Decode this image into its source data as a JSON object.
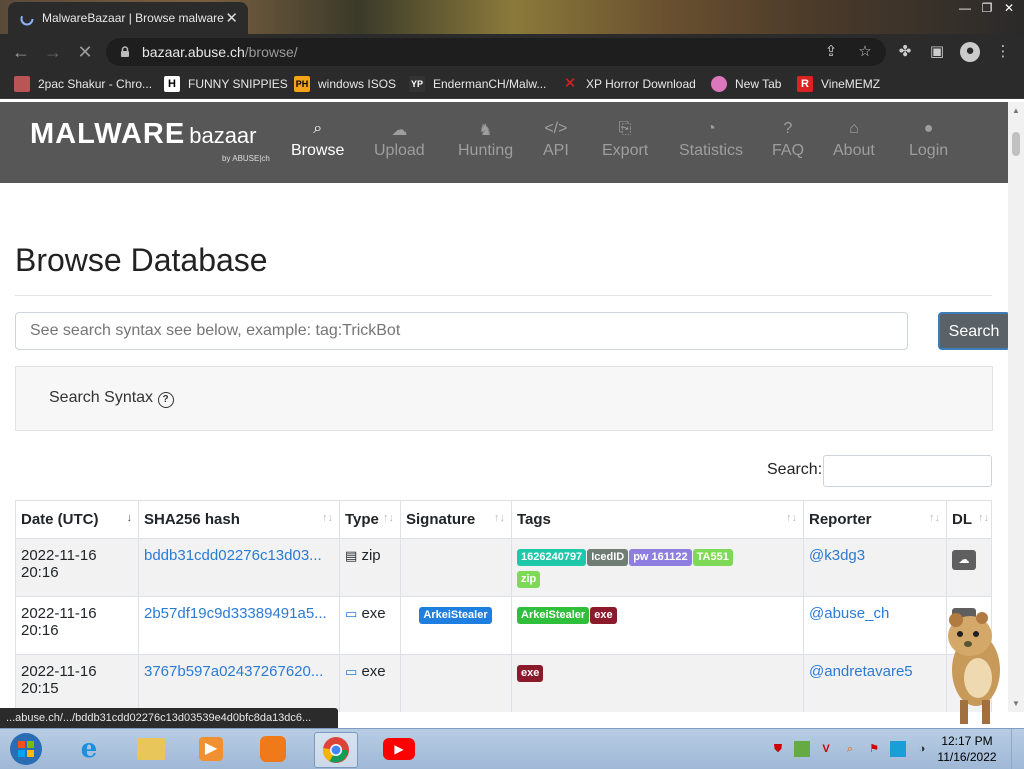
{
  "browser": {
    "tab_title": "MalwareBazaar | Browse malware",
    "url_host": "bazaar.abuse.ch",
    "url_path": "/browse/",
    "bookmarks": [
      {
        "label": "2pac Shakur - Chro...",
        "icon": "thumbnail-icon"
      },
      {
        "label": "FUNNY SNIPPIES",
        "icon": "h-icon"
      },
      {
        "label": "windows ISOS",
        "icon": "ph-icon"
      },
      {
        "label": "EndermanCH/Malw...",
        "icon": "yp-icon"
      },
      {
        "label": "XP Horror Download",
        "icon": "x-icon"
      },
      {
        "label": "New Tab",
        "icon": "globe-icon"
      },
      {
        "label": "VineMEMZ",
        "icon": "r-icon"
      }
    ],
    "status_url": "...abuse.ch/.../bddb31cdd02276c13d03539e4d0bfc8da13dc6..."
  },
  "site": {
    "logo_main": "MALWARE",
    "logo_sub": "bazaar",
    "logo_by": "by ABUSE|ch",
    "nav": [
      {
        "label": "Browse",
        "icon": "search-icon",
        "active": true
      },
      {
        "label": "Upload",
        "icon": "cloud-upload-icon"
      },
      {
        "label": "Hunting",
        "icon": "hunting-icon"
      },
      {
        "label": "API",
        "icon": "code-icon"
      },
      {
        "label": "Export",
        "icon": "export-icon"
      },
      {
        "label": "Statistics",
        "icon": "pie-chart-icon"
      },
      {
        "label": "FAQ",
        "icon": "question-icon"
      },
      {
        "label": "About",
        "icon": "building-icon"
      },
      {
        "label": "Login",
        "icon": "user-icon"
      }
    ]
  },
  "page": {
    "heading": "Browse Database",
    "search_placeholder": "See search syntax see below, example: tag:TrickBot",
    "search_button": "Search",
    "syntax_label": "Search Syntax",
    "table_search_label": "Search:"
  },
  "table": {
    "columns": [
      "Date (UTC)",
      "SHA256 hash",
      "Type",
      "Signature",
      "Tags",
      "Reporter",
      "DL"
    ],
    "rows": [
      {
        "date": "2022-11-16",
        "time": "20:16",
        "hash": "bddb31cdd02276c13d03...",
        "type": "zip",
        "type_icon": "file-zip-icon",
        "signature": "",
        "tags": [
          {
            "text": "1626240797",
            "color": "#1fc8a9"
          },
          {
            "text": "IcedID",
            "color": "#6f7d75"
          },
          {
            "text": "pw 161122",
            "color": "#8e7ee0"
          },
          {
            "text": "TA551",
            "color": "#7ed957"
          },
          {
            "text": "zip",
            "color": "#7ed957"
          }
        ],
        "reporter": "@k3dg3"
      },
      {
        "date": "2022-11-16",
        "time": "20:16",
        "hash": "2b57df19c9d33389491a5...",
        "type": "exe",
        "type_icon": "window-icon",
        "signature": "ArkeiStealer",
        "signature_color": "#1f7fe0",
        "tags": [
          {
            "text": "ArkeiStealer",
            "color": "#2fbf3a"
          },
          {
            "text": "exe",
            "color": "#8b1a2b"
          }
        ],
        "reporter": "@abuse_ch"
      },
      {
        "date": "2022-11-16",
        "time": "20:15",
        "hash": "3767b597a02437267620...",
        "type": "exe",
        "type_icon": "window-icon",
        "signature": "",
        "tags": [
          {
            "text": "exe",
            "color": "#8b1a2b"
          }
        ],
        "reporter": "@andretavare5"
      }
    ]
  },
  "taskbar": {
    "time": "12:17 PM",
    "date": "11/16/2022"
  }
}
